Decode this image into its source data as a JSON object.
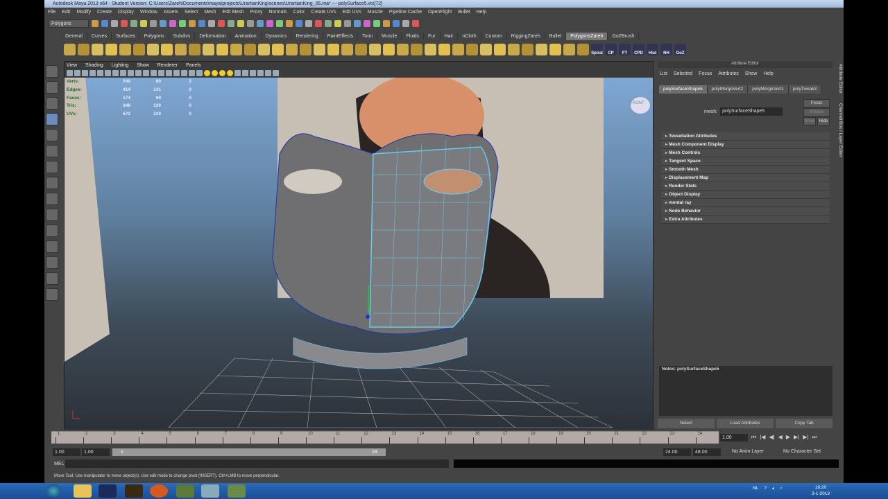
{
  "window": {
    "title": "Autodesk Maya 2013 x64 - Student Version: C:\\Users\\Zareh\\Documents\\maya\\projects\\UrartianKing\\scenes\\UrartianKing_05.ma*   ---   polySurface5.vtx[72]"
  },
  "menu": [
    "File",
    "Edit",
    "Modify",
    "Create",
    "Display",
    "Window",
    "Assets",
    "Select",
    "Mesh",
    "Edit Mesh",
    "Proxy",
    "Normals",
    "Color",
    "Create UVs",
    "Edit UVs",
    "Muscle",
    "Pipeline Cache",
    "OpenFlight",
    "Bullet",
    "Help"
  ],
  "toolbar": {
    "mode": "Polygons"
  },
  "shelf_tabs": [
    "General",
    "Curves",
    "Surfaces",
    "Polygons",
    "Subdivs",
    "Deformation",
    "Animation",
    "Dynamics",
    "Rendering",
    "PaintEffects",
    "Toon",
    "Muscle",
    "Fluids",
    "Fur",
    "Hair",
    "nCloth",
    "Custom",
    "RiggingZareh",
    "Bullet",
    "PolygonsZareh",
    "GoZBrush"
  ],
  "shelf_active": "PolygonsZareh",
  "shelf_labels": [
    "Spiral",
    "CP",
    "FT",
    "CPD",
    "Hist",
    "NH",
    "GoZ"
  ],
  "viewport": {
    "menu": [
      "View",
      "Shading",
      "Lighting",
      "Show",
      "Renderer",
      "Panels"
    ],
    "view_cube": "FRONT",
    "stats": [
      {
        "label": "Verts:",
        "v": [
          "240",
          "80",
          "2"
        ]
      },
      {
        "label": "Edges:",
        "v": [
          "414",
          "141",
          "0"
        ]
      },
      {
        "label": "Faces:",
        "v": [
          "174",
          "69",
          "0"
        ]
      },
      {
        "label": "Tris:",
        "v": [
          "348",
          "120",
          "0"
        ]
      },
      {
        "label": "UVs:",
        "v": [
          "672",
          "220",
          "0"
        ]
      }
    ]
  },
  "attribute_editor": {
    "title": "Attribute Editor",
    "menu": [
      "List",
      "Selected",
      "Focus",
      "Attributes",
      "Show",
      "Help"
    ],
    "tabs": [
      "polySurfaceShape5",
      "polyMergeVert2",
      "polyMergeVert1",
      "polyTweak3"
    ],
    "mesh_label": "mesh:",
    "mesh_value": "polySurfaceShape5",
    "focus": "Focus",
    "presets": "Presets",
    "show": "Show",
    "hide": "Hide",
    "sections": [
      "Tessellation Attributes",
      "Mesh Component Display",
      "Mesh Controls",
      "Tangent Space",
      "Smooth Mesh",
      "Displacement Map",
      "Render Stats",
      "Object Display",
      "mental ray",
      "Node Behavior",
      "Extra Attributes"
    ],
    "notes": "Notes: polySurfaceShape5",
    "buttons": [
      "Select",
      "Load Attributes",
      "Copy Tab"
    ]
  },
  "side_tabs": [
    "Attribute Editor",
    "Channel Box / Layer Editor"
  ],
  "timeline": {
    "frames": [
      "1",
      "2",
      "3",
      "4",
      "5",
      "6",
      "7",
      "8",
      "9",
      "10",
      "11",
      "12",
      "13",
      "14",
      "15",
      "16",
      "17",
      "18",
      "19",
      "20",
      "21",
      "22",
      "23",
      "24"
    ],
    "current": "1.00"
  },
  "range": {
    "start": "1.00",
    "playStart": "1.00",
    "sliderStart": "1",
    "sliderEnd": "24",
    "playEnd": "24.00",
    "end": "48.00",
    "anim_layer": "No Anim Layer",
    "char_set": "No Character Set"
  },
  "command": {
    "label": "MEL"
  },
  "help_line": "Move Tool: Use manipulator to move object(s). Use edit mode to change pivot (INSERT).  Ctrl+LMB to move perpendicular.",
  "taskbar": {
    "lang": "NL",
    "time": "16:20",
    "date": "3-1-2013"
  }
}
